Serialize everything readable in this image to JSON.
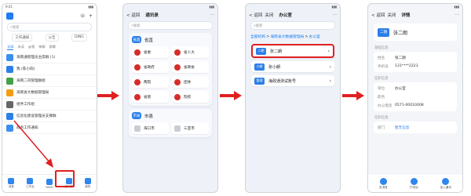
{
  "screen1": {
    "status_time": "9:41",
    "top_icons": [
      "phone-icon",
      "plus-icon"
    ],
    "search_placeholder": "搜索",
    "quick": [
      "工作通知",
      "公告",
      "DING"
    ],
    "tabs": [
      "全部",
      "未读",
      "@我",
      "单聊",
      "群聊"
    ],
    "chats": [
      {
        "title": "海南通管理员主席群 (1)",
        "sub": "..."
      },
      {
        "title": "我 (陈小四)",
        "sub": ""
      },
      {
        "title": "海南二司管理群组",
        "sub": ""
      },
      {
        "title": "海南省大数据管理局",
        "sub": ""
      },
      {
        "title": "组件工作组",
        "sub": ""
      },
      {
        "title": "信息化建设管理员支撑群",
        "sub": ""
      },
      {
        "title": "政务工作通知",
        "sub": ""
      }
    ],
    "bottom_tabs": [
      "消息",
      "工作台",
      "DING",
      "通讯录",
      "我的"
    ]
  },
  "screen2": {
    "back": "< 返回",
    "title": "通讯录",
    "more": "···",
    "search_placeholder": "搜索",
    "province": {
      "tag": "省直",
      "label": "省直",
      "items": [
        "省委",
        "省人大",
        "省政府",
        "省政协",
        "两院",
        "团体",
        "省管",
        "院校"
      ]
    },
    "city": {
      "tag": "市县",
      "label": "市县",
      "items": [
        "海口市",
        "三亚市"
      ]
    }
  },
  "screen3": {
    "back": "< 返回",
    "close": "关闭",
    "title": "办公室",
    "more": "···",
    "search_placeholder": "搜索",
    "breadcrumb": [
      "全部机构",
      "海南省大数据管理局",
      "办公室"
    ],
    "people": [
      {
        "badge": "二朗",
        "name": "张二朗"
      },
      {
        "badge": "小朗",
        "name": "张小朗"
      },
      {
        "badge": "管理",
        "name": "海政通测试账号"
      }
    ]
  },
  "screen4": {
    "back": "< 返回",
    "close": "关闭",
    "title": "详情",
    "more": "···",
    "person": {
      "badge": "二朗",
      "name": "张二朗"
    },
    "basic_title": "基础信息",
    "basic": [
      {
        "k": "姓名",
        "v": "张二朗"
      },
      {
        "k": "手机号",
        "v": "131****2223"
      }
    ],
    "job_title": "任职信息",
    "job": [
      {
        "k": "单位",
        "v": "办公室"
      },
      {
        "k": "职务",
        "v": ""
      },
      {
        "k": "办公电话",
        "v": "0571-00010008"
      }
    ],
    "other_title": "任职信息",
    "other": [
      {
        "k": "部门",
        "v": "暂无信息"
      }
    ],
    "actions": [
      "发消息",
      "打电话",
      "加入通讯"
    ]
  },
  "colors": {
    "accent": "#1f7cf2",
    "highlight": "#e02020",
    "arrow": "#e02020"
  }
}
